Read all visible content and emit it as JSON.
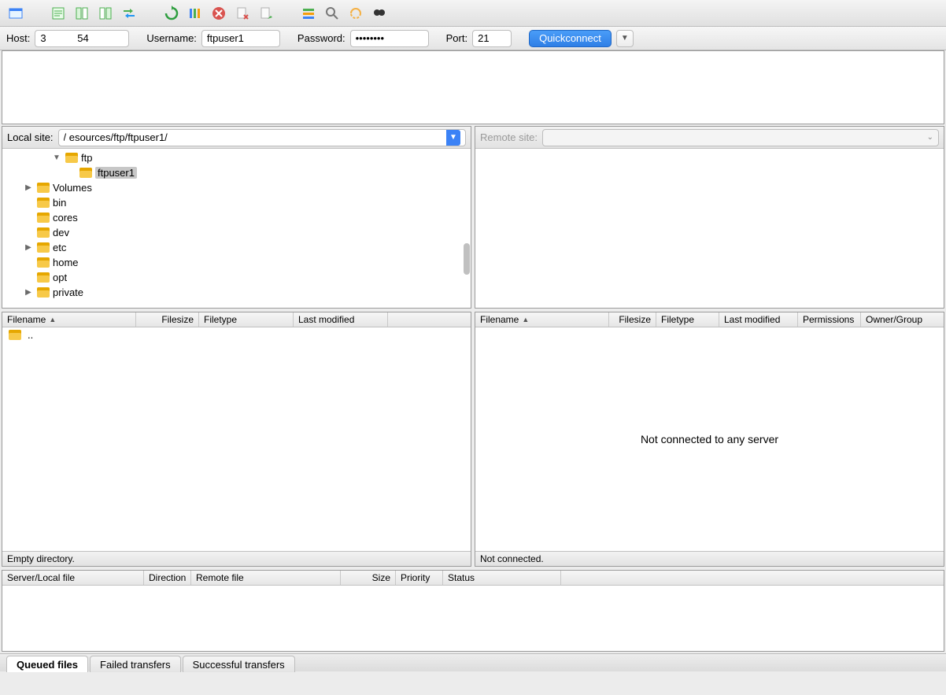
{
  "connection": {
    "host_label": "Host:",
    "host_value": "3           54",
    "user_label": "Username:",
    "user_value": "ftpuser1",
    "pass_label": "Password:",
    "pass_value": "••••••••",
    "port_label": "Port:",
    "port_value": "21",
    "quickconnect_label": "Quickconnect"
  },
  "local": {
    "site_label": "Local site:",
    "site_value": "/                   esources/ftp/ftpuser1/",
    "tree": [
      {
        "indent": 3,
        "expander": "▼",
        "name": "ftp"
      },
      {
        "indent": 4,
        "expander": "",
        "name": "ftpuser1",
        "selected": true
      },
      {
        "indent": 1,
        "expander": "▶",
        "name": "Volumes"
      },
      {
        "indent": 1,
        "expander": "",
        "name": "bin"
      },
      {
        "indent": 1,
        "expander": "",
        "name": "cores"
      },
      {
        "indent": 1,
        "expander": "",
        "name": "dev"
      },
      {
        "indent": 1,
        "expander": "▶",
        "name": "etc"
      },
      {
        "indent": 1,
        "expander": "",
        "name": "home"
      },
      {
        "indent": 1,
        "expander": "",
        "name": "opt"
      },
      {
        "indent": 1,
        "expander": "▶",
        "name": "private"
      }
    ],
    "list_headers": [
      "Filename",
      "Filesize",
      "Filetype",
      "Last modified"
    ],
    "list_rows": [
      {
        "name": ".."
      }
    ],
    "status": "Empty directory."
  },
  "remote": {
    "site_label": "Remote site:",
    "site_value": "",
    "list_headers": [
      "Filename",
      "Filesize",
      "Filetype",
      "Last modified",
      "Permissions",
      "Owner/Group"
    ],
    "empty_message": "Not connected to any server",
    "status": "Not connected."
  },
  "queue": {
    "headers": [
      "Server/Local file",
      "Direction",
      "Remote file",
      "Size",
      "Priority",
      "Status"
    ]
  },
  "tabs": {
    "queued": "Queued files",
    "failed": "Failed transfers",
    "successful": "Successful transfers"
  }
}
